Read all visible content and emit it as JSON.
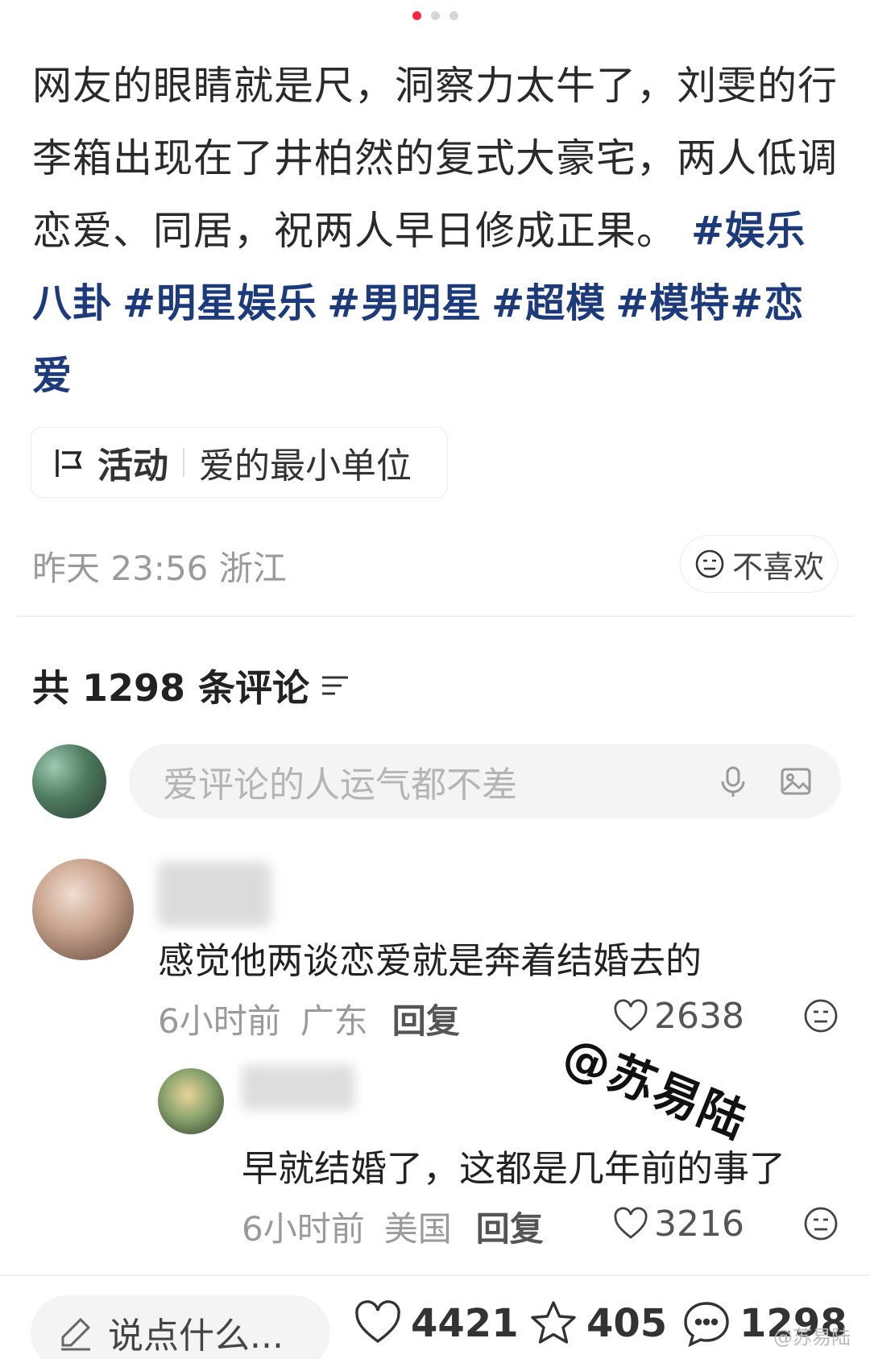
{
  "carousel": {
    "count": 3,
    "active": 0
  },
  "post": {
    "text": "网友的眼睛就是尺，洞察力太牛了，刘雯的行李箱出现在了井柏然的复式大豪宅，两人低调恋爱、同居，祝两人早日修成正果。",
    "tags": [
      "#娱乐八卦",
      "#明星娱乐",
      "#男明星",
      "#超模",
      "#模特",
      "#恋爱"
    ]
  },
  "activity": {
    "label": "活动",
    "title": "爱的最小单位"
  },
  "meta": {
    "time": "昨天 23:56",
    "location": "浙江"
  },
  "dislike_label": "不喜欢",
  "comments": {
    "count_label": "共 1298 条评论",
    "input_placeholder": "爱评论的人运气都不差",
    "items": [
      {
        "text": "感觉他两谈恋爱就是奔着结婚去的",
        "time": "6小时前",
        "location": "广东",
        "reply": "回复",
        "likes": "2638"
      }
    ],
    "replies": [
      {
        "text": "早就结婚了，这都是几年前的事了",
        "time": "6小时前",
        "location": "美国",
        "reply": "回复",
        "likes": "3216"
      }
    ]
  },
  "watermark": "@苏易陆",
  "bottom_bar": {
    "say": "说点什么...",
    "likes": "4421",
    "favorites": "405",
    "comments": "1298"
  },
  "corner_watermark": "@苏易陆",
  "colors": {
    "accent": "#ff2442",
    "tag": "#1d3a7a",
    "muted": "#9a9a9a"
  }
}
